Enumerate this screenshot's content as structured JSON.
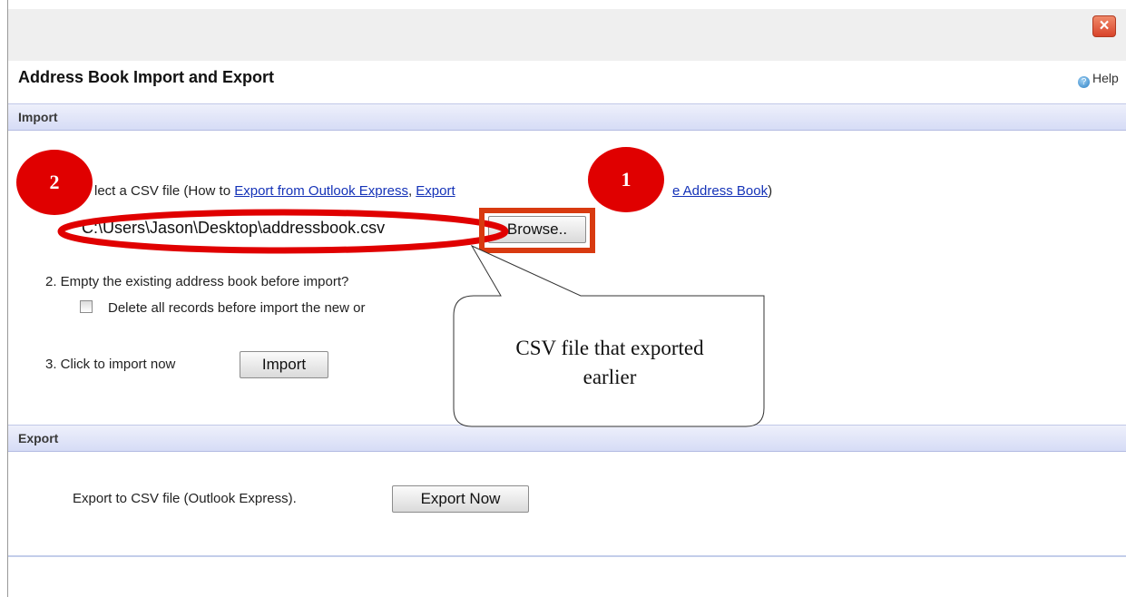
{
  "dialog": {
    "title": "Address Book Import and Export",
    "help_label": "Help",
    "close_glyph": "×"
  },
  "import": {
    "section_label": "Import",
    "step1": {
      "prefix": "lect a CSV file (How to ",
      "link1": "Export from Outlook Express",
      "separator": ", ",
      "link2": "Export",
      "link3": "e Address Book",
      "suffix": ")"
    },
    "file_path": "C:\\Users\\Jason\\Desktop\\addressbook.csv",
    "browse_label": "Browse..",
    "step2": "2.  Empty the existing address book before import?",
    "checkbox_label": "Delete all records before import the new or",
    "step3": "3.  Click to import now",
    "import_button": "Import"
  },
  "export": {
    "section_label": "Export",
    "text": "Export to CSV file (Outlook Express).",
    "button": "Export Now"
  },
  "annotations": {
    "badge1": "1",
    "badge2": "2",
    "callout_line1": "CSV file that exported",
    "callout_line2": "earlier",
    "highlight_color": "#e00000",
    "box_color": "#d83a10"
  },
  "icons": {
    "close": "close-icon",
    "help": "help-icon"
  }
}
